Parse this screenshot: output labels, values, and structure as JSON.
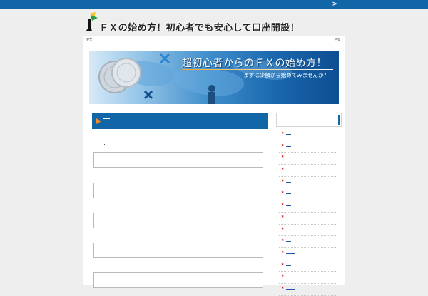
{
  "topbar": {
    "chevron": ">"
  },
  "header": {
    "site_title": "ＦＸの始め方！初心者でも安心して口座開設！"
  },
  "breadcrumb": {
    "left": "FX",
    "right": "FX"
  },
  "banner": {
    "title": "超初心者からのＦＸの始め方！",
    "subtitle": "まずは少額から始めてみませんか？"
  },
  "main": {
    "section_heading_label": "▶",
    "input_boxes": 5
  },
  "sidebar": {
    "items": [
      {
        "icon": "red-star-icon"
      },
      {
        "icon": "red-star-icon"
      },
      {
        "icon": "red-star-icon"
      },
      {
        "icon": "red-star-icon"
      },
      {
        "icon": "red-star-icon"
      },
      {
        "icon": "red-star-icon"
      },
      {
        "icon": "red-star-icon"
      },
      {
        "icon": "red-star-icon"
      },
      {
        "icon": "red-star-icon"
      },
      {
        "icon": "red-star-icon"
      },
      {
        "icon": "red-star-icon"
      },
      {
        "icon": "red-star-icon"
      },
      {
        "icon": "red-star-icon"
      },
      {
        "icon": "red-star-icon"
      }
    ]
  },
  "colors": {
    "accent_blue": "#1166a8",
    "bullet_red": "#d92b2b",
    "arrow_orange": "#f28c28",
    "page_bg": "#eeeeee"
  }
}
